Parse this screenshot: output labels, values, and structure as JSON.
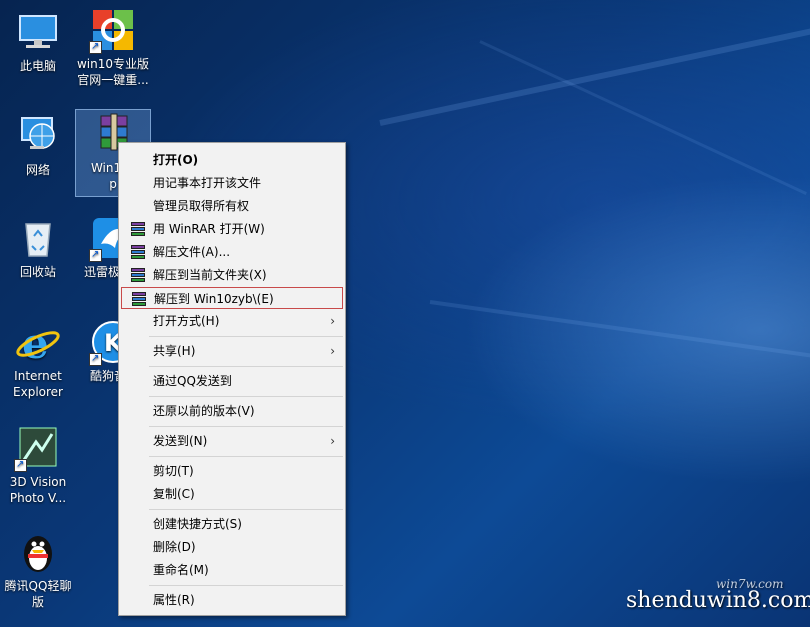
{
  "desktop": {
    "icons": [
      {
        "label": "此电脑"
      },
      {
        "label": "win10专业版\n官网一键重..."
      },
      {
        "label": "网络"
      },
      {
        "label": "Win10z\np"
      },
      {
        "label": "回收站"
      },
      {
        "label": "迅雷极"
      },
      {
        "label": "Internet\nExplorer"
      },
      {
        "label": "酷狗音"
      },
      {
        "label": "3D Vision\nPhoto V..."
      },
      {
        "label": "腾讯QQ轻聊\n版"
      }
    ]
  },
  "context_menu": {
    "items": {
      "open": "打开(O)",
      "notepad": "用记事本打开该文件",
      "take_ownership": "管理员取得所有权",
      "open_winrar": "用 WinRAR 打开(W)",
      "extract_files": "解压文件(A)...",
      "extract_here": "解压到当前文件夹(X)",
      "extract_to": "解压到 Win10zyb\\(E)",
      "open_with": "打开方式(H)",
      "share": "共享(H)",
      "send_qq": "通过QQ发送到",
      "restore": "还原以前的版本(V)",
      "send_to": "发送到(N)",
      "cut": "剪切(T)",
      "copy": "复制(C)",
      "create_shortcut": "创建快捷方式(S)",
      "delete": "删除(D)",
      "rename": "重命名(M)",
      "properties": "属性(R)"
    },
    "submenu_arrow": "›",
    "highlight_color": "#c84a4a"
  },
  "watermark": {
    "main": "shenduwin8.com",
    "sub": "win7w.com"
  }
}
